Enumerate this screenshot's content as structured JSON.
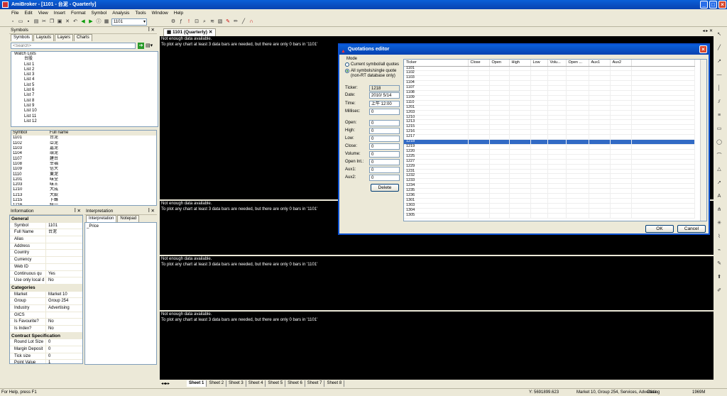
{
  "window": {
    "title": "AmiBroker - [1101 - 台泥 - Quarterly]"
  },
  "menu": [
    "File",
    "Edit",
    "View",
    "Insert",
    "Format",
    "Symbol",
    "Analysis",
    "Tools",
    "Window",
    "Help"
  ],
  "toolbar": {
    "symbol_value": "1101"
  },
  "symbols_panel": {
    "title": "Symbols",
    "tabs": [
      "Symbols",
      "Layouts",
      "Layers",
      "Charts"
    ],
    "search_placeholder": "<Search>",
    "tree": [
      "Watch Lists",
      "台股",
      "List 1",
      "List 2",
      "List 3",
      "List 4",
      "List 5",
      "List 6",
      "List 7",
      "List 8",
      "List 9",
      "List 10",
      "List 11",
      "List 12"
    ],
    "columns": [
      "Symbol",
      "Full name"
    ],
    "rows": [
      [
        "1101",
        "台泥"
      ],
      [
        "1102",
        "亞泥"
      ],
      [
        "1103",
        "嘉泥"
      ],
      [
        "1104",
        "環泥"
      ],
      [
        "1107",
        "建台"
      ],
      [
        "1108",
        "幸福"
      ],
      [
        "1109",
        "信大"
      ],
      [
        "1110",
        "東泥"
      ],
      [
        "1201",
        "味全"
      ],
      [
        "1203",
        "味王"
      ],
      [
        "1210",
        "大成"
      ],
      [
        "1213",
        "大飲"
      ],
      [
        "1215",
        "卜蜂"
      ],
      [
        "1216",
        "統一"
      ]
    ]
  },
  "info_panel": {
    "title": "Information",
    "sections": [
      {
        "name": "General",
        "rows": [
          [
            "Symbol",
            "1101"
          ],
          [
            "Full Name",
            "台泥"
          ],
          [
            "Alias",
            ""
          ],
          [
            "Address",
            ""
          ],
          [
            "Country",
            ""
          ],
          [
            "Currency",
            ""
          ],
          [
            "Web ID",
            ""
          ],
          [
            "Continuous qu",
            "Yes"
          ],
          [
            "Use only local d",
            "No"
          ]
        ]
      },
      {
        "name": "Categories",
        "rows": [
          [
            "Market",
            "Market 10"
          ],
          [
            "Group",
            "Group 254"
          ],
          [
            "Industry",
            "Advertising"
          ],
          [
            "GICS",
            ""
          ],
          [
            "Is Favourite?",
            "No"
          ],
          [
            "Is Index?",
            "No"
          ]
        ]
      },
      {
        "name": "Contract Specification",
        "rows": [
          [
            "Round Lot Size",
            "0"
          ],
          [
            "Margin Deposit",
            "0"
          ],
          [
            "Tick size",
            "0"
          ],
          [
            "Point Value",
            "1"
          ]
        ]
      }
    ]
  },
  "interp_panel": {
    "title": "Interpretation",
    "tabs": [
      "Interpretation",
      "Notepad"
    ],
    "text": "_Price"
  },
  "doc_tab": {
    "label": "1101 (Quarterly)"
  },
  "chart_msg": {
    "line1": "Not enough data available.",
    "line2": "To plot any chart at least 3 data bars are needed, but there are only 0 bars in '1101'"
  },
  "dialog": {
    "title": "Quotations editor",
    "mode_label": "Mode",
    "mode_opt1": "Current symbol/all quotes",
    "mode_opt2": "All symbols/single quote (non-RT database only)",
    "fields": {
      "ticker_label": "Ticker:",
      "ticker": "1218",
      "date_label": "Date:",
      "date": "2010/ 5/14",
      "time_label": "Time:",
      "time": "上午 12:00",
      "millisec_label": "Millisec:",
      "millisec": "0",
      "open_label": "Open:",
      "open": "0",
      "high_label": "High:",
      "high": "0",
      "low_label": "Low:",
      "low": "0",
      "close_label": "Close:",
      "close": "0",
      "volume_label": "Volume:",
      "volume": "0",
      "openint_label": "Open Int.:",
      "openint": "0",
      "aux1_label": "Aux1:",
      "aux1": "0",
      "aux2_label": "Aux2:",
      "aux2": "0"
    },
    "delete_label": "Delete",
    "ok_label": "OK",
    "cancel_label": "Cancel",
    "grid_columns": [
      "Ticker",
      "Close",
      "Open",
      "High",
      "Low",
      "Volu...",
      "Open ...",
      "Aux1",
      "Aux2"
    ],
    "grid_rows": [
      "1101",
      "1102",
      "1103",
      "1104",
      "1107",
      "1108",
      "1109",
      "1110",
      "1201",
      "1203",
      "1210",
      "1213",
      "1215",
      "1216",
      "1217",
      "1218",
      "1219",
      "1220",
      "1225",
      "1227",
      "1229",
      "1231",
      "1232",
      "1233",
      "1234",
      "1235",
      "1236",
      "1301",
      "1303",
      "1304",
      "1305"
    ],
    "selected": "1218"
  },
  "sheets": [
    "Sheet 1",
    "Sheet 2",
    "Sheet 3",
    "Sheet 4",
    "Sheet 5",
    "Sheet 6",
    "Sheet 7",
    "Sheet 8"
  ],
  "status": {
    "help": "For Help, press F1",
    "coords": "Y: 5691899.623",
    "info": "Market 10, Group 254, Services, Advertising",
    "db": "Data",
    "mem": "1969M"
  }
}
